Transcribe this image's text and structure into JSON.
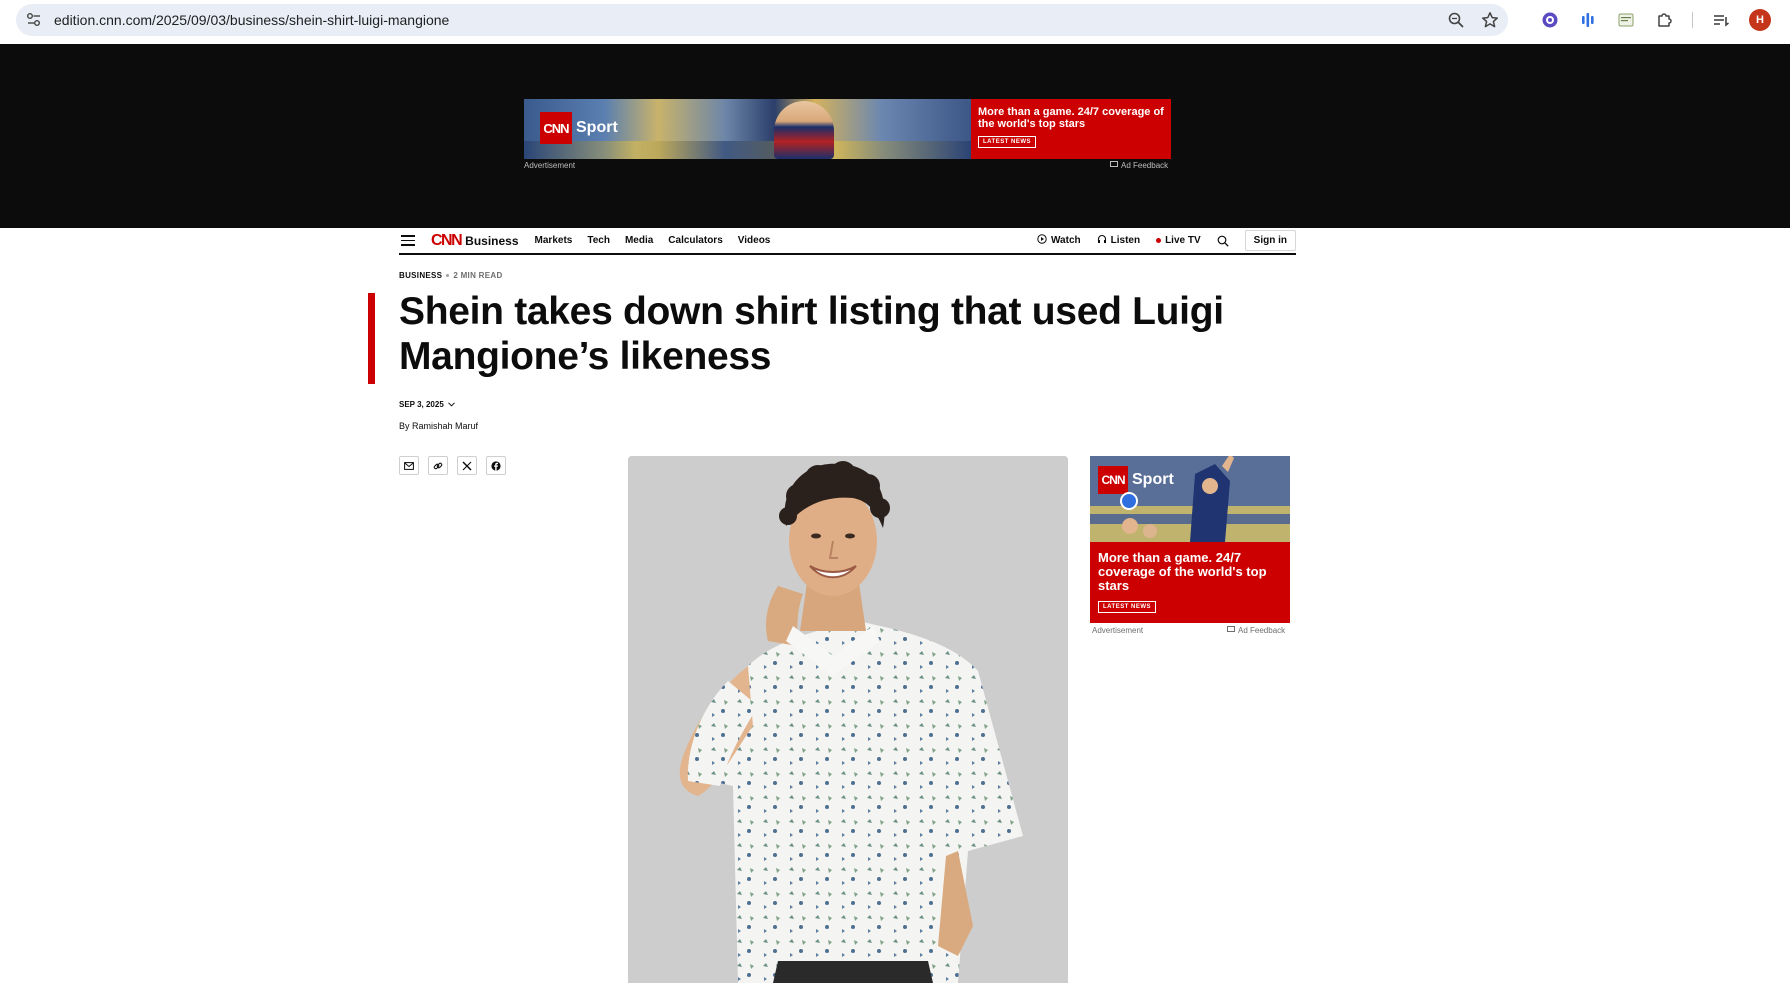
{
  "browser": {
    "url": "edition.cnn.com/2025/09/03/business/shein-shirt-luigi-mangione",
    "profile_initial": "H",
    "icons": [
      "tune-icon",
      "zoom-icon",
      "bookmark-star-icon",
      "extension-1-icon",
      "extension-2-icon",
      "extension-3-icon",
      "extensions-puzzle-icon",
      "reading-list-icon"
    ]
  },
  "leaderboard_ad": {
    "brand": "CNN",
    "sport": "Sport",
    "tagline": "More than a game. 24/7 coverage of the world's top stars",
    "cta": "LATEST NEWS",
    "label": "Advertisement",
    "feedback": "Ad Feedback"
  },
  "nav": {
    "logo": "CNN",
    "section": "Business",
    "links": [
      "Markets",
      "Tech",
      "Media",
      "Calculators",
      "Videos"
    ],
    "watch": "Watch",
    "listen": "Listen",
    "live_tv": "Live TV",
    "sign_in": "Sign in"
  },
  "article": {
    "section": "BUSINESS",
    "read_time": "2 MIN READ",
    "headline": "Shein takes down shirt listing that used Luigi Mangione’s likeness",
    "date": "SEP 3, 2025",
    "byline": "By Ramishah Maruf"
  },
  "share": {
    "items": [
      "email-icon",
      "link-icon",
      "x-icon",
      "facebook-icon"
    ]
  },
  "side_ad": {
    "brand": "CNN",
    "sport": "Sport",
    "tagline": "More than a game. 24/7 coverage of the world's top stars",
    "cta": "LATEST NEWS",
    "label": "Advertisement",
    "feedback": "Ad Feedback"
  },
  "colors": {
    "cnn_red": "#cc0000",
    "ad_band": "#0c0c0c",
    "omnibox": "#e9eef6"
  }
}
